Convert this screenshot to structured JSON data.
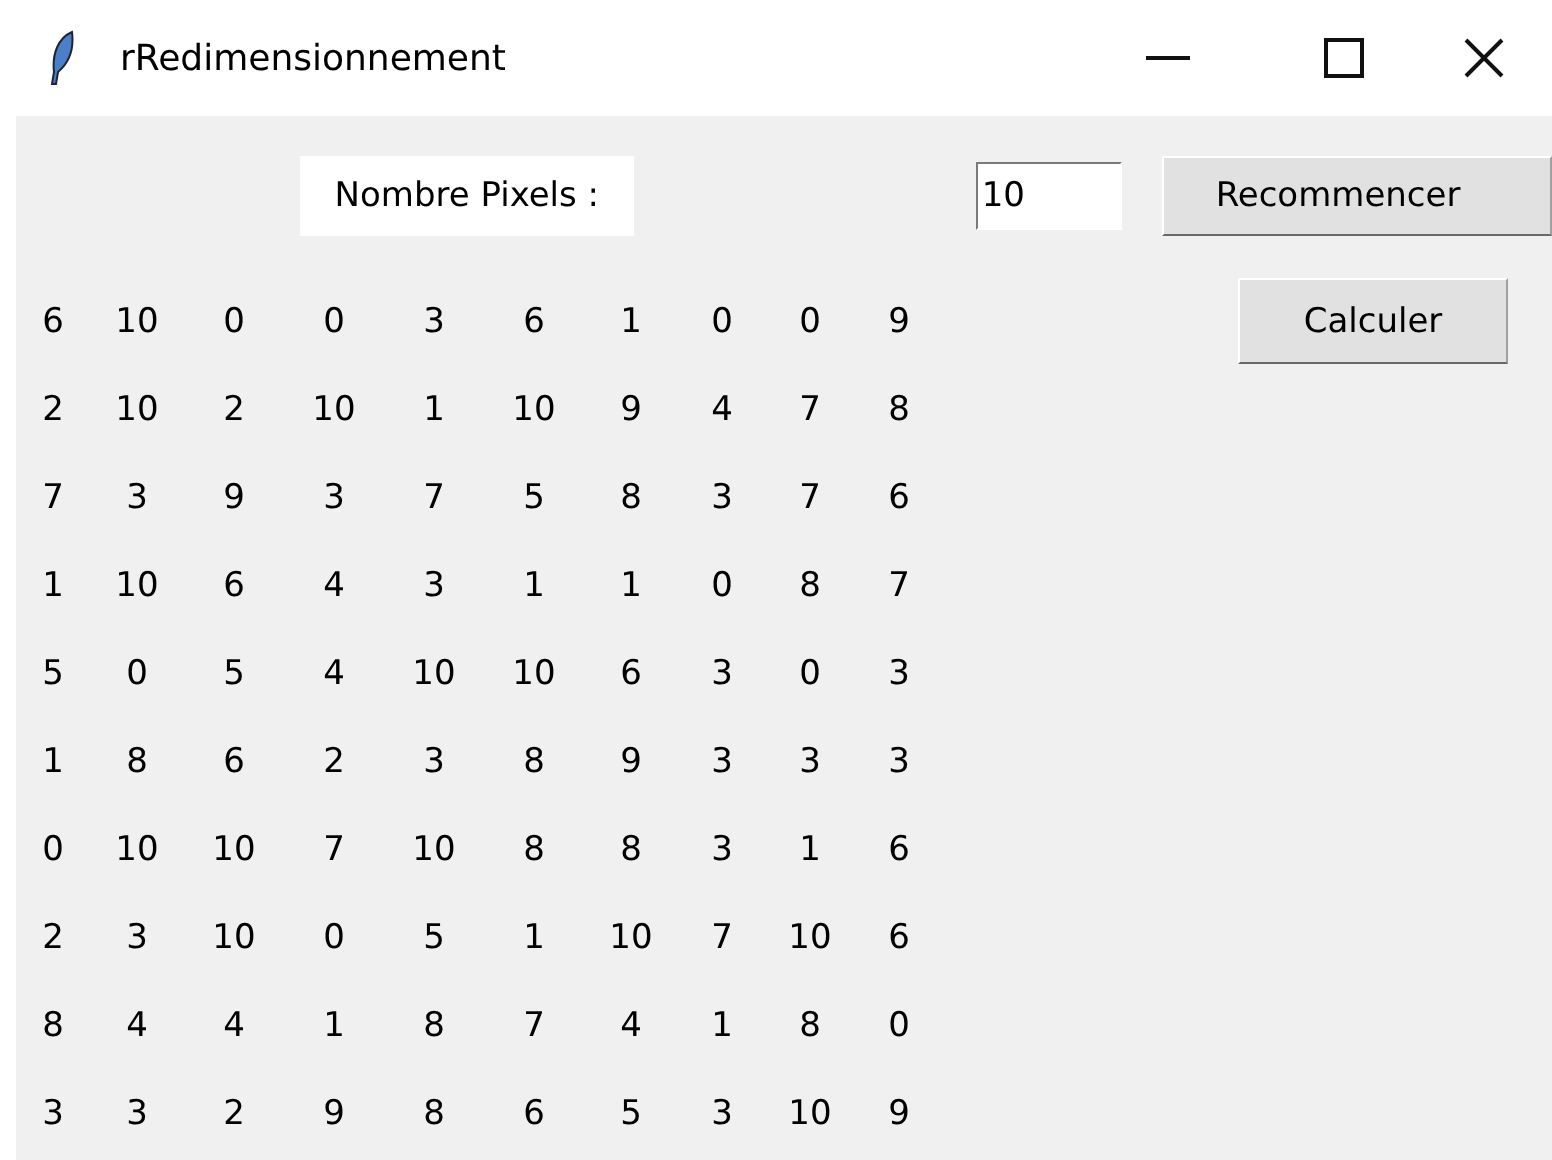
{
  "window": {
    "title": "rRedimensionnement"
  },
  "pixels_label": "Nombre Pixels :",
  "pixels_field": {
    "value": "10"
  },
  "buttons": [
    {
      "label": "Recommencer"
    },
    {
      "label": "Calculer"
    }
  ],
  "matrix": [
    [
      "6",
      "10",
      "0",
      "0",
      "3",
      "6",
      "1",
      "0",
      "0",
      "9"
    ],
    [
      "2",
      "10",
      "2",
      "10",
      "1",
      "10",
      "9",
      "4",
      "7",
      "8"
    ],
    [
      "7",
      "3",
      "9",
      "3",
      "7",
      "5",
      "8",
      "3",
      "7",
      "6"
    ],
    [
      "1",
      "10",
      "6",
      "4",
      "3",
      "1",
      "1",
      "0",
      "8",
      "7"
    ],
    [
      "5",
      "0",
      "5",
      "4",
      "10",
      "10",
      "6",
      "3",
      "0",
      "3"
    ],
    [
      "1",
      "8",
      "6",
      "2",
      "3",
      "8",
      "9",
      "3",
      "3",
      "3"
    ],
    [
      "0",
      "10",
      "10",
      "7",
      "10",
      "8",
      "8",
      "3",
      "1",
      "6"
    ],
    [
      "2",
      "3",
      "10",
      "0",
      "5",
      "1",
      "10",
      "7",
      "10",
      "6"
    ],
    [
      "8",
      "4",
      "4",
      "1",
      "8",
      "7",
      "4",
      "1",
      "8",
      "0"
    ],
    [
      "3",
      "3",
      "2",
      "9",
      "8",
      "6",
      "5",
      "3",
      "10",
      "9"
    ]
  ]
}
